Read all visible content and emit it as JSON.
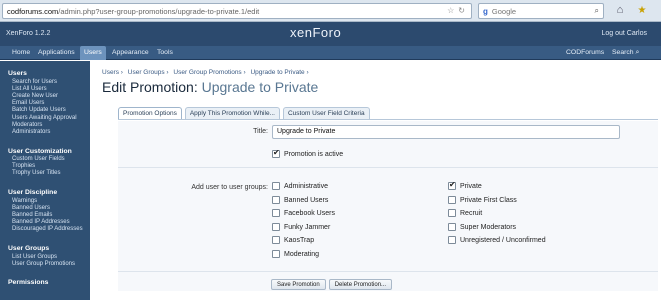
{
  "browser": {
    "url_host": "codforums.com",
    "url_path": "/admin.php?user-group-promotions/upgrade-to-private.1/edit",
    "search_placeholder": "Google"
  },
  "header": {
    "version": "XenForo 1.2.2",
    "logo": "xenForo",
    "logout": "Log out Carlos"
  },
  "nav": {
    "tabs": [
      "Home",
      "Applications",
      "Users",
      "Appearance",
      "Tools"
    ],
    "right_link": "CODForums",
    "search": "Search"
  },
  "sidebar": {
    "groups": [
      {
        "head": "Users",
        "items": [
          "Search for Users",
          "List All Users",
          "Create New User",
          "Email Users",
          "Batch Update Users",
          "Users Awaiting Approval",
          "Moderators",
          "Administrators"
        ]
      },
      {
        "head": "User Customization",
        "items": [
          "Custom User Fields",
          "Trophies",
          "Trophy User Titles"
        ]
      },
      {
        "head": "User Discipline",
        "items": [
          "Warnings",
          "Banned Users",
          "Banned Emails",
          "Banned IP Addresses",
          "Discouraged IP Addresses"
        ]
      },
      {
        "head": "User Groups",
        "items": [
          "List User Groups",
          "User Group Promotions"
        ]
      },
      {
        "head": "Permissions",
        "items": []
      }
    ]
  },
  "breadcrumb": [
    "Users ›",
    "User Groups ›",
    "User Group Promotions ›",
    "Upgrade to Private ›"
  ],
  "page": {
    "title_prefix": "Edit Promotion: ",
    "title_name": "Upgrade to Private"
  },
  "tabs": [
    "Promotion Options",
    "Apply This Promotion While...",
    "Custom User Field Criteria"
  ],
  "form": {
    "title_label": "Title:",
    "title_value": "Upgrade to Private",
    "active_label": "Promotion is active",
    "groups_label": "Add user to user groups:",
    "groups_left": [
      {
        "label": "Administrative",
        "checked": false
      },
      {
        "label": "Banned Users",
        "checked": false
      },
      {
        "label": "Facebook Users",
        "checked": false
      },
      {
        "label": "Funky Jammer",
        "checked": false
      },
      {
        "label": "KaosTrap",
        "checked": false
      },
      {
        "label": "Moderating",
        "checked": false
      }
    ],
    "groups_right": [
      {
        "label": "Private",
        "checked": true
      },
      {
        "label": "Private First Class",
        "checked": false
      },
      {
        "label": "Recruit",
        "checked": false
      },
      {
        "label": "Super Moderators",
        "checked": false
      },
      {
        "label": "Unregistered / Unconfirmed",
        "checked": false
      }
    ],
    "save_button": "Save Promotion",
    "delete_button": "Delete Promotion..."
  }
}
